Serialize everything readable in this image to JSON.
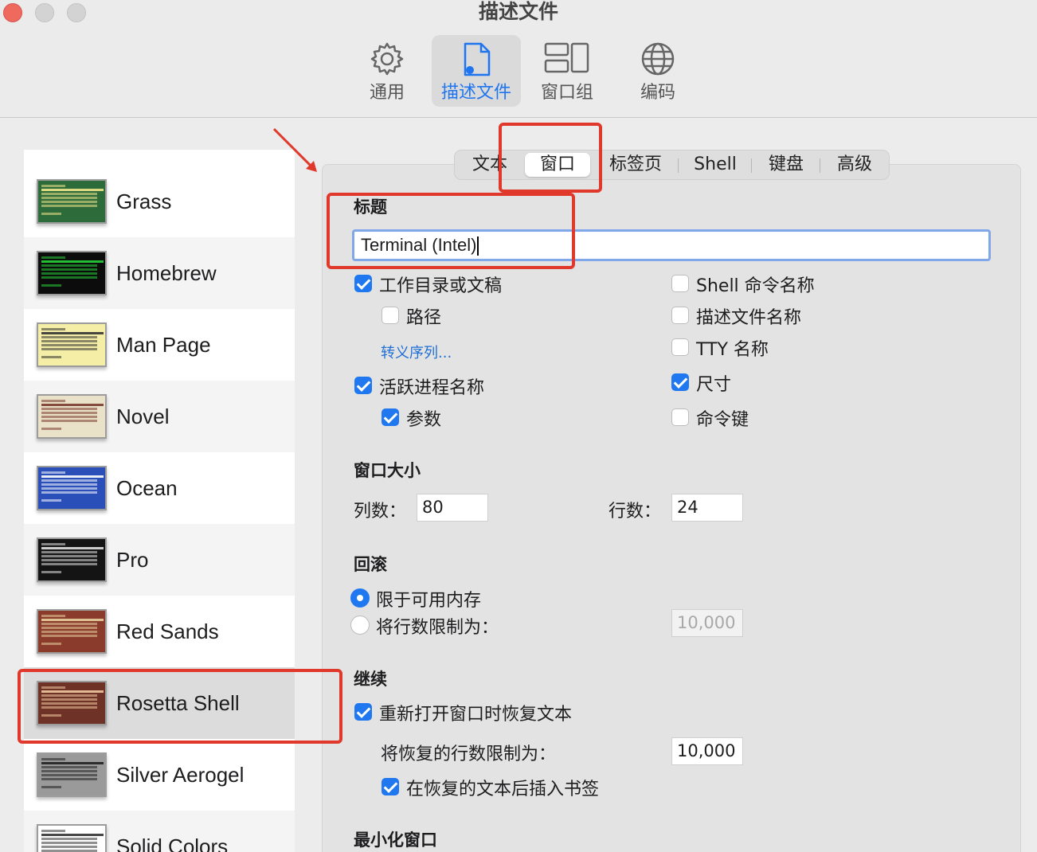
{
  "window": {
    "title": "描述文件"
  },
  "toolbar": {
    "items": [
      {
        "label": "通用",
        "icon": "gear-icon"
      },
      {
        "label": "描述文件",
        "icon": "profile-document-icon",
        "active": true
      },
      {
        "label": "窗口组",
        "icon": "window-group-icon"
      },
      {
        "label": "编码",
        "icon": "globe-icon"
      }
    ]
  },
  "sidebar": {
    "profiles": [
      {
        "name": "Grass",
        "bg": "#2e6b3a",
        "fg": "#f0e68c"
      },
      {
        "name": "Homebrew",
        "bg": "#0c0c0c",
        "fg": "#27d23a"
      },
      {
        "name": "Man Page",
        "bg": "#f4eea6",
        "fg": "#333333"
      },
      {
        "name": "Novel",
        "bg": "#e9e2c8",
        "fg": "#7a3b2e"
      },
      {
        "name": "Ocean",
        "bg": "#2a4fb8",
        "fg": "#ffffff"
      },
      {
        "name": "Pro",
        "bg": "#141414",
        "fg": "#e0e0e0"
      },
      {
        "name": "Red Sands",
        "bg": "#8a3b2c",
        "fg": "#e8d2a0"
      },
      {
        "name": "Rosetta Shell",
        "bg": "#6e3226",
        "fg": "#f0c8a0"
      },
      {
        "name": "Silver Aerogel",
        "bg": "#9a9a9a",
        "fg": "#202020"
      },
      {
        "name": "Solid Colors",
        "bg": "#ffffff",
        "fg": "#333333"
      }
    ]
  },
  "tabs": [
    "文本",
    "窗口",
    "标签页",
    "Shell",
    "键盘",
    "高级"
  ],
  "title_section": {
    "heading": "标题",
    "value": "Terminal (Intel)",
    "left_options": [
      {
        "label": "工作目录或文稿",
        "checked": true
      },
      {
        "label": "路径",
        "checked": false
      }
    ],
    "escape_link": "转义序列...",
    "left_options2": [
      {
        "label": "活跃进程名称",
        "checked": true
      },
      {
        "label": "参数",
        "checked": true
      }
    ],
    "right_options": [
      {
        "label": "Shell 命令名称",
        "checked": false
      },
      {
        "label": "描述文件名称",
        "checked": false
      },
      {
        "label": "TTY 名称",
        "checked": false
      },
      {
        "label": "尺寸",
        "checked": true
      },
      {
        "label": "命令键",
        "checked": false
      }
    ]
  },
  "window_size": {
    "heading": "窗口大小",
    "columns_label": "列数：",
    "columns_value": "80",
    "rows_label": "行数：",
    "rows_value": "24"
  },
  "scrollback": {
    "heading": "回滚",
    "option1": "限于可用内存",
    "option2": "将行数限制为：",
    "limit_value": "10,000"
  },
  "resume": {
    "heading": "继续",
    "restore_text": "重新打开窗口时恢复文本",
    "limit_label": "将恢复的行数限制为：",
    "limit_value": "10,000",
    "bookmark": "在恢复的文本后插入书签"
  },
  "minimize": {
    "heading": "最小化窗口"
  },
  "colors": {
    "accent": "#1f78f0",
    "annotation": "#e0392b"
  }
}
